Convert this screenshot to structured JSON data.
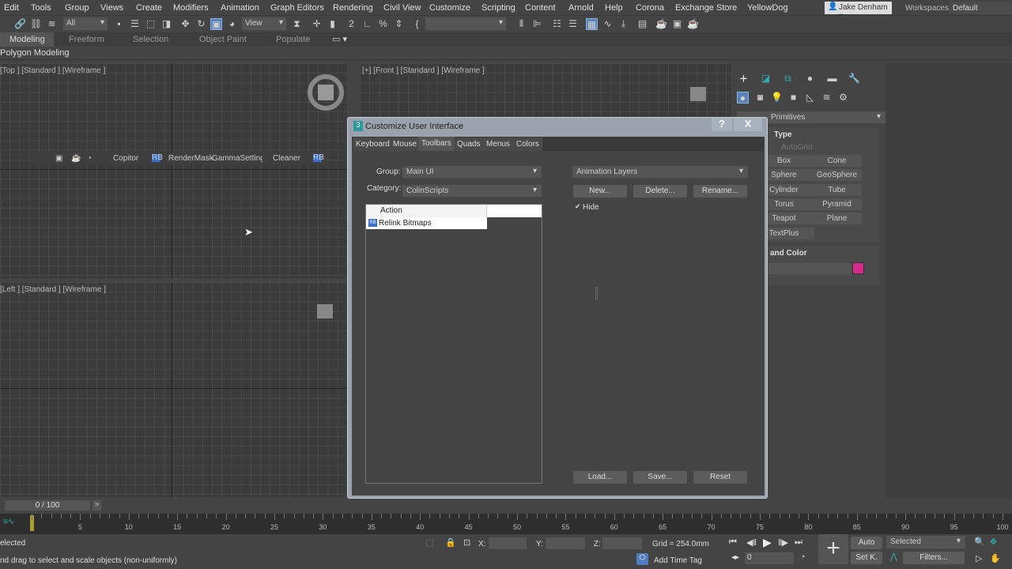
{
  "menu": [
    "Edit",
    "Tools",
    "Group",
    "Views",
    "Create",
    "Modifiers",
    "Animation",
    "Graph Editors",
    "Rendering",
    "Civil View",
    "Customize",
    "Scripting",
    "Content",
    "Arnold",
    "Help",
    "Corona",
    "Exchange Store",
    "YellowDog"
  ],
  "user": "Jake Denham",
  "workspaces_label": "Workspaces:",
  "workspace": "Default",
  "toolbar": {
    "selection_filter": "All",
    "ref_coord": "View"
  },
  "ribbon": {
    "tabs": [
      "Modeling",
      "Freeform",
      "Selection",
      "Object Paint",
      "Populate"
    ],
    "sub": "Polygon Modeling"
  },
  "viewports": {
    "top": "[Top ] [Standard ] [Wireframe ]",
    "front": "[+] [Front ] [Standard ] [Wireframe ]",
    "left": "[Left ] [Standard ] [Wireframe ]"
  },
  "floatbar": [
    "Copitor",
    "RenderMask",
    "GammaSettings",
    "Cleaner"
  ],
  "command_panel": {
    "dropdown": "Primitives",
    "rollout1": "Type",
    "autogrid": "AutoGrid",
    "buttons": [
      "Box",
      "Cone",
      "Sphere",
      "GeoSphere",
      "Cylinder",
      "Tube",
      "Torus",
      "Pyramid",
      "Teapot",
      "Plane",
      "TextPlus"
    ],
    "rollout2": "and Color",
    "color": "#d62a8a"
  },
  "dialog": {
    "title": "Customize User Interface",
    "tabs": [
      "Keyboard",
      "Mouse",
      "Toolbars",
      "Quads",
      "Menus",
      "Colors"
    ],
    "active_tab": "Toolbars",
    "group_label": "Group:",
    "group": "Main UI",
    "category_label": "Category:",
    "category": "ColinScripts",
    "list_header": "Action",
    "actions": [
      "Relink Bitmaps"
    ],
    "toolbar_select": "Animation Layers",
    "new": "New...",
    "delete": "Delete...",
    "rename": "Rename...",
    "hide": "Hide",
    "load": "Load...",
    "save": "Save...",
    "reset": "Reset",
    "help": "?",
    "close": "X"
  },
  "timeline": {
    "slider": "0 / 100",
    "start": 0,
    "end": 100,
    "current": 0,
    "label_step": 5
  },
  "status": {
    "selected": "elected",
    "prompt": "nd drag to select and scale objects (non-uniformly)",
    "x": "X:",
    "y": "Y:",
    "z": "Z:",
    "grid": "Grid = 254.0mm",
    "add_time_tag": "Add Time Tag",
    "frame": "0",
    "auto": "Auto",
    "set_key": "Set K.",
    "key_filter": "Selected",
    "filters": "Filters..."
  }
}
